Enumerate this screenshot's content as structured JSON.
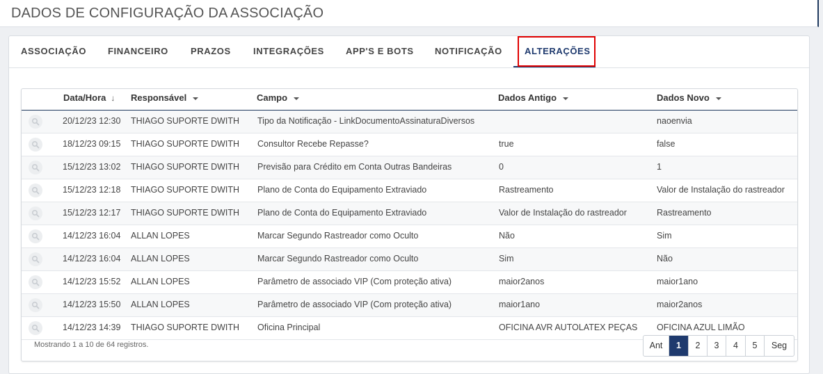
{
  "page": {
    "title": "DADOS DE CONFIGURAÇÃO DA ASSOCIAÇÃO"
  },
  "tabs": [
    {
      "label": "ASSOCIAÇÃO"
    },
    {
      "label": "FINANCEIRO"
    },
    {
      "label": "PRAZOS"
    },
    {
      "label": "INTEGRAÇÕES"
    },
    {
      "label": "APP'S E BOTS"
    },
    {
      "label": "NOTIFICAÇÃO"
    },
    {
      "label": "ALTERAÇÕES",
      "active": true
    }
  ],
  "table": {
    "columns": {
      "datetime": "Data/Hora",
      "user": "Responsável",
      "field": "Campo",
      "old": "Dados Antigo",
      "new": "Dados Novo"
    },
    "rows": [
      {
        "datetime": "20/12/23 12:30",
        "user": "THIAGO SUPORTE DWITH",
        "field": "Tipo da Notificação - LinkDocumentoAssinaturaDiversos",
        "old": "",
        "new": "naoenvia"
      },
      {
        "datetime": "18/12/23 09:15",
        "user": "THIAGO SUPORTE DWITH",
        "field": "Consultor Recebe Repasse?",
        "old": "true",
        "new": "false"
      },
      {
        "datetime": "15/12/23 13:02",
        "user": "THIAGO SUPORTE DWITH",
        "field": "Previsão para Crédito em Conta Outras Bandeiras",
        "old": "0",
        "new": "1"
      },
      {
        "datetime": "15/12/23 12:18",
        "user": "THIAGO SUPORTE DWITH",
        "field": "Plano de Conta do Equipamento Extraviado",
        "old": "Rastreamento",
        "new": "Valor de Instalação do rastreador"
      },
      {
        "datetime": "15/12/23 12:17",
        "user": "THIAGO SUPORTE DWITH",
        "field": "Plano de Conta do Equipamento Extraviado",
        "old": "Valor de Instalação do rastreador",
        "new": "Rastreamento"
      },
      {
        "datetime": "14/12/23 16:04",
        "user": "ALLAN LOPES",
        "field": "Marcar Segundo Rastreador como Oculto",
        "old": "Não",
        "new": "Sim"
      },
      {
        "datetime": "14/12/23 16:04",
        "user": "ALLAN LOPES",
        "field": "Marcar Segundo Rastreador como Oculto",
        "old": "Sim",
        "new": "Não"
      },
      {
        "datetime": "14/12/23 15:52",
        "user": "ALLAN LOPES",
        "field": "Parâmetro de associado VIP (Com proteção ativa)",
        "old": "maior2anos",
        "new": "maior1ano"
      },
      {
        "datetime": "14/12/23 15:50",
        "user": "ALLAN LOPES",
        "field": "Parâmetro de associado VIP (Com proteção ativa)",
        "old": "maior1ano",
        "new": "maior2anos"
      },
      {
        "datetime": "14/12/23 14:39",
        "user": "THIAGO SUPORTE DWITH",
        "field": "Oficina Principal",
        "old": "OFICINA AVR AUTOLATEX PEÇAS",
        "new": "OFICINA AZUL LIMÃO"
      }
    ],
    "info": "Mostrando 1 a 10 de 64 registros."
  },
  "pagination": {
    "prev": "Ant",
    "pages": [
      "1",
      "2",
      "3",
      "4",
      "5"
    ],
    "current": "1",
    "next": "Seg"
  },
  "icons": {
    "row_action": "search-icon",
    "sort_active": "arrow-down-icon",
    "sort_inactive": "caret-down-icon"
  },
  "colors": {
    "accent": "#1f3a6e",
    "highlight": "#e00000"
  }
}
